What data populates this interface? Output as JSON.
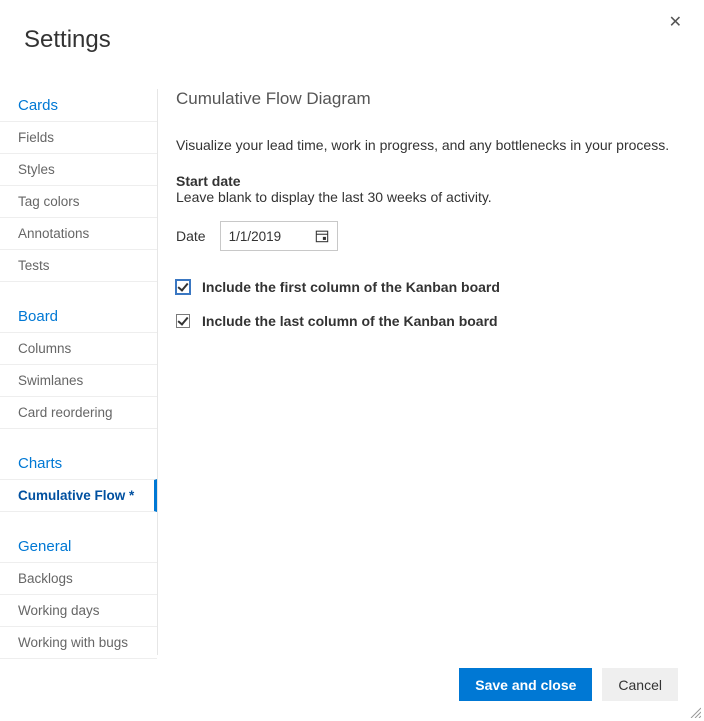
{
  "title": "Settings",
  "close_label": "✕",
  "sidebar": {
    "sections": [
      {
        "header": "Cards",
        "items": [
          {
            "label": "Fields"
          },
          {
            "label": "Styles"
          },
          {
            "label": "Tag colors"
          },
          {
            "label": "Annotations"
          },
          {
            "label": "Tests"
          }
        ]
      },
      {
        "header": "Board",
        "items": [
          {
            "label": "Columns"
          },
          {
            "label": "Swimlanes"
          },
          {
            "label": "Card reordering"
          }
        ]
      },
      {
        "header": "Charts",
        "items": [
          {
            "label": "Cumulative Flow *",
            "active": true
          }
        ]
      },
      {
        "header": "General",
        "items": [
          {
            "label": "Backlogs"
          },
          {
            "label": "Working days"
          },
          {
            "label": "Working with bugs"
          }
        ]
      }
    ]
  },
  "content": {
    "heading": "Cumulative Flow Diagram",
    "description": "Visualize your lead time, work in progress, and any bottlenecks in your process.",
    "start_date_label": "Start date",
    "start_date_hint": "Leave blank to display the last 30 weeks of activity.",
    "date_label": "Date",
    "date_value": "1/1/2019",
    "include_first_label": "Include the first column of the Kanban board",
    "include_first_checked": true,
    "include_last_label": "Include the last column of the Kanban board",
    "include_last_checked": true
  },
  "footer": {
    "save_label": "Save and close",
    "cancel_label": "Cancel"
  }
}
